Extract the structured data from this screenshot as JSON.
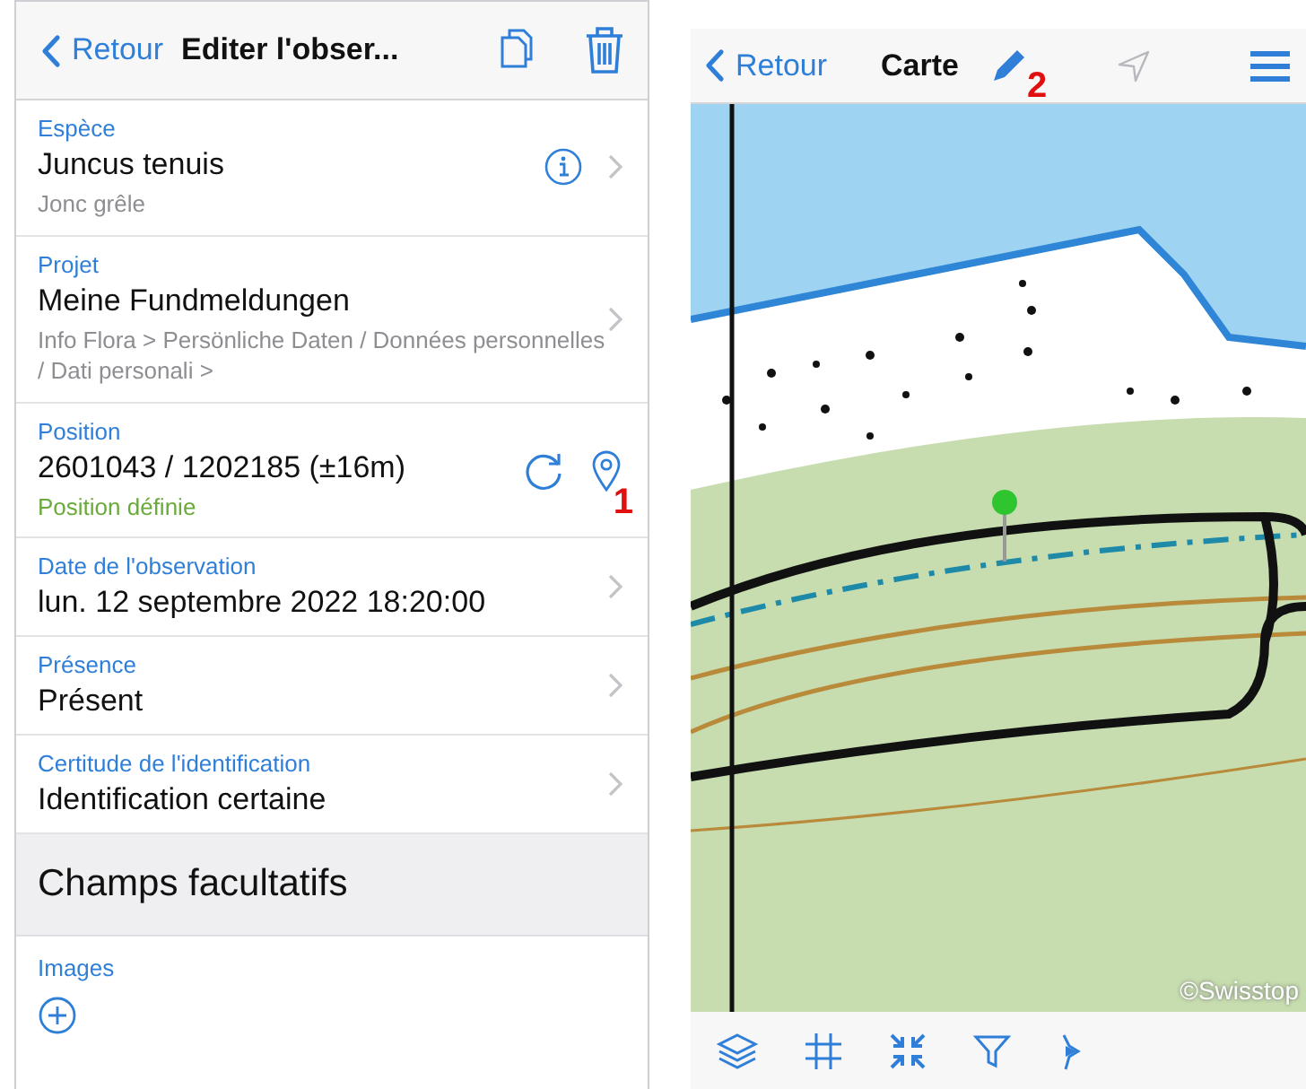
{
  "edit_screen": {
    "nav": {
      "back": "Retour",
      "title": "Editer l'obser..."
    },
    "fields": [
      {
        "kind": "species",
        "label": "Espèce",
        "value": "Juncus tenuis",
        "detail": "Jonc grêle"
      },
      {
        "kind": "link",
        "label": "Projet",
        "value": "Meine Fundmeldungen",
        "detail": "Info Flora > Persönliche Daten / Données personnelles / Dati personali >"
      },
      {
        "kind": "position",
        "label": "Position",
        "value": "2601043 / 1202185 (±16m)",
        "detail": "Position définie",
        "marker": "1"
      },
      {
        "kind": "link",
        "label": "Date de l'observation",
        "value": "lun. 12 septembre 2022 18:20:00"
      },
      {
        "kind": "link",
        "label": "Présence",
        "value": "Présent"
      },
      {
        "kind": "link",
        "label": "Certitude de l'identification",
        "value": "Identification certaine"
      }
    ],
    "section_title": "Champs facultatifs",
    "images_label": "Images"
  },
  "map_screen": {
    "nav": {
      "back": "Retour",
      "title": "Carte",
      "marker": "2",
      "location_enabled": false
    },
    "attribution": "©Swisstop"
  }
}
